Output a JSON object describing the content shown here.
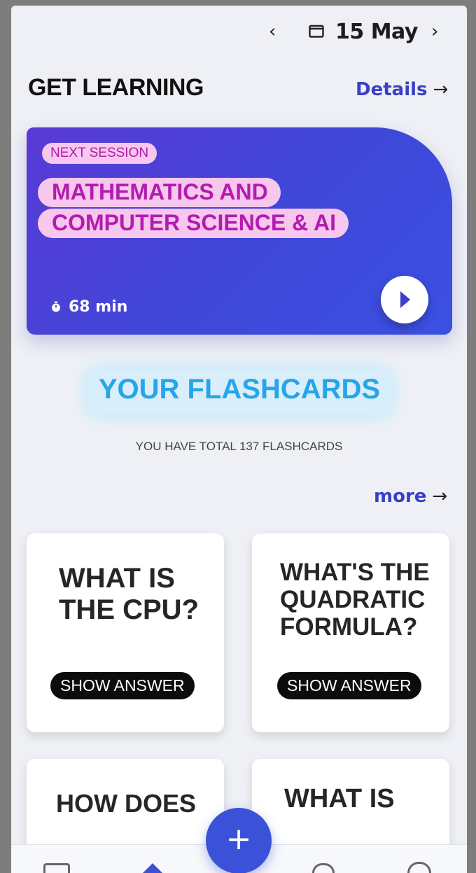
{
  "date_nav": {
    "prev": "‹",
    "next": "›",
    "date": "15 May",
    "icon": "calendar-icon"
  },
  "header": {
    "title": "GET LEARNING",
    "details_label": "Details",
    "arrow": "→"
  },
  "session": {
    "badge": "NEXT SESSION",
    "title": "MATHEMATICS AND COMPUTER SCIENCE & AI",
    "duration": "68 min",
    "timer_icon": "stopwatch-icon",
    "play_icon": "play-icon"
  },
  "flashcards": {
    "title": "YOUR FLASHCARDS",
    "count_text": "YOU HAVE TOTAL 137 FLASHCARDS",
    "more_label": "more",
    "arrow": "→",
    "cards": [
      {
        "question": "WHAT IS THE CPU?",
        "button": "SHOW ANSWER"
      },
      {
        "question": "WHAT'S THE QUADRATIC FORMULA?",
        "button": "SHOW ANSWER"
      },
      {
        "question": "HOW DOES",
        "button": ""
      },
      {
        "question": "WHAT IS",
        "button": ""
      }
    ]
  },
  "fab": {
    "label": "+"
  },
  "colors": {
    "accent": "#3b52d8",
    "session_bg": "#4a3fd8",
    "badge": "#f7c7ee",
    "flash_title": "#27a5e8"
  }
}
